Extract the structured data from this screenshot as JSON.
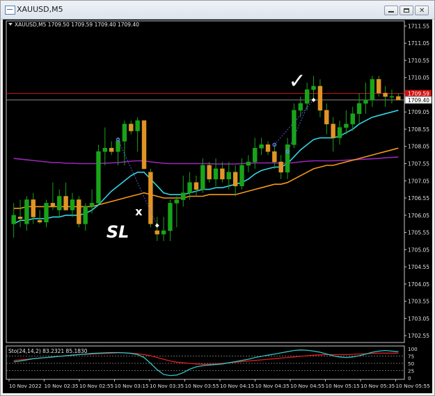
{
  "window": {
    "title": "XAUUSD,M5",
    "minimize_icon": "minimize-icon",
    "restore_icon": "restore-icon",
    "close_icon": "close-icon"
  },
  "chart": {
    "info_label": "XAUUSD,M5  1709.50 1709.59 1709.40 1709.40",
    "current_price_label": "1709.40",
    "red_line_label": "1709.59",
    "colors": {
      "background": "#000000",
      "bull_candle": "#19a319",
      "bear_candle": "#e19426",
      "ma_cyan": "#33d6e6",
      "ma_orange": "#f59a18",
      "ma_purple": "#9a28b8",
      "red_line": "#d01010"
    },
    "annotations": {
      "checkmark": "✓",
      "sl_text": "SL",
      "x_mark": "x"
    }
  },
  "stochastic": {
    "label": "Sto(24,14,2) 83.2321 85.1830",
    "levels": [
      "100",
      "75",
      "50",
      "25",
      "0"
    ]
  },
  "chart_data": {
    "type": "candlestick",
    "symbol": "XAUUSD",
    "timeframe": "M5",
    "y_ticks": [
      "1711.55",
      "1711.05",
      "1710.55",
      "1710.05",
      "1709.55",
      "1709.05",
      "1708.55",
      "1708.05",
      "1707.55",
      "1707.05",
      "1706.55",
      "1706.05",
      "1705.55",
      "1705.05",
      "1704.55",
      "1704.05",
      "1703.55",
      "1703.05",
      "1702.55"
    ],
    "x_ticks": [
      "10 Nov 2022",
      "10 Nov 02:35",
      "10 Nov 02:55",
      "10 Nov 03:15",
      "10 Nov 03:35",
      "10 Nov 03:55",
      "10 Nov 04:15",
      "10 Nov 04:35",
      "10 Nov 04:55",
      "10 Nov 05:15",
      "10 Nov 05:35",
      "10 Nov 05:55"
    ],
    "ylim": [
      1702.35,
      1711.7
    ],
    "candles": [
      {
        "o": 1705.8,
        "h": 1706.4,
        "l": 1705.4,
        "c": 1706.05
      },
      {
        "o": 1706.0,
        "h": 1706.5,
        "l": 1705.7,
        "c": 1705.95
      },
      {
        "o": 1705.8,
        "h": 1706.6,
        "l": 1705.6,
        "c": 1706.5
      },
      {
        "o": 1706.5,
        "h": 1706.7,
        "l": 1705.8,
        "c": 1706.0
      },
      {
        "o": 1705.9,
        "h": 1706.2,
        "l": 1705.8,
        "c": 1705.85
      },
      {
        "o": 1705.85,
        "h": 1706.5,
        "l": 1705.7,
        "c": 1706.4
      },
      {
        "o": 1706.4,
        "h": 1707.0,
        "l": 1706.2,
        "c": 1706.3
      },
      {
        "o": 1706.2,
        "h": 1706.8,
        "l": 1706.0,
        "c": 1706.6
      },
      {
        "o": 1706.6,
        "h": 1707.0,
        "l": 1706.2,
        "c": 1706.2
      },
      {
        "o": 1706.2,
        "h": 1706.7,
        "l": 1706.0,
        "c": 1706.5
      },
      {
        "o": 1706.5,
        "h": 1706.6,
        "l": 1705.7,
        "c": 1705.8
      },
      {
        "o": 1705.8,
        "h": 1706.4,
        "l": 1705.6,
        "c": 1706.3
      },
      {
        "o": 1706.3,
        "h": 1706.8,
        "l": 1706.1,
        "c": 1706.4
      },
      {
        "o": 1706.4,
        "h": 1708.1,
        "l": 1706.4,
        "c": 1707.9
      },
      {
        "o": 1707.9,
        "h": 1708.6,
        "l": 1707.5,
        "c": 1708.0
      },
      {
        "o": 1708.0,
        "h": 1708.2,
        "l": 1707.8,
        "c": 1707.9
      },
      {
        "o": 1707.9,
        "h": 1708.3,
        "l": 1707.5,
        "c": 1708.2
      },
      {
        "o": 1708.2,
        "h": 1708.8,
        "l": 1707.5,
        "c": 1708.7
      },
      {
        "o": 1708.7,
        "h": 1708.8,
        "l": 1708.4,
        "c": 1708.5
      },
      {
        "o": 1708.5,
        "h": 1708.9,
        "l": 1707.9,
        "c": 1708.8
      },
      {
        "o": 1708.8,
        "h": 1708.8,
        "l": 1707.4,
        "c": 1707.4
      },
      {
        "o": 1707.3,
        "h": 1707.4,
        "l": 1705.7,
        "c": 1705.8
      },
      {
        "o": 1705.6,
        "h": 1706.0,
        "l": 1705.3,
        "c": 1705.5
      },
      {
        "o": 1705.5,
        "h": 1706.0,
        "l": 1705.3,
        "c": 1705.6
      },
      {
        "o": 1705.6,
        "h": 1706.5,
        "l": 1705.3,
        "c": 1706.4
      },
      {
        "o": 1706.4,
        "h": 1706.6,
        "l": 1705.7,
        "c": 1706.5
      },
      {
        "o": 1706.5,
        "h": 1707.2,
        "l": 1706.3,
        "c": 1706.7
      },
      {
        "o": 1706.7,
        "h": 1707.3,
        "l": 1706.5,
        "c": 1707.0
      },
      {
        "o": 1707.0,
        "h": 1707.2,
        "l": 1706.6,
        "c": 1706.8
      },
      {
        "o": 1706.8,
        "h": 1707.7,
        "l": 1706.7,
        "c": 1707.5
      },
      {
        "o": 1707.5,
        "h": 1707.6,
        "l": 1707.0,
        "c": 1707.1
      },
      {
        "o": 1707.1,
        "h": 1707.7,
        "l": 1706.9,
        "c": 1707.4
      },
      {
        "o": 1707.4,
        "h": 1707.6,
        "l": 1707.0,
        "c": 1707.1
      },
      {
        "o": 1707.1,
        "h": 1707.6,
        "l": 1706.8,
        "c": 1707.3
      },
      {
        "o": 1707.3,
        "h": 1707.5,
        "l": 1706.6,
        "c": 1706.9
      },
      {
        "o": 1706.9,
        "h": 1707.7,
        "l": 1706.8,
        "c": 1707.5
      },
      {
        "o": 1707.5,
        "h": 1707.8,
        "l": 1707.3,
        "c": 1707.6
      },
      {
        "o": 1707.6,
        "h": 1708.3,
        "l": 1707.4,
        "c": 1708.0
      },
      {
        "o": 1708.0,
        "h": 1708.3,
        "l": 1707.8,
        "c": 1708.1
      },
      {
        "o": 1708.1,
        "h": 1708.2,
        "l": 1707.8,
        "c": 1707.9
      },
      {
        "o": 1707.9,
        "h": 1708.1,
        "l": 1707.4,
        "c": 1707.6
      },
      {
        "o": 1707.6,
        "h": 1707.8,
        "l": 1707.1,
        "c": 1707.3
      },
      {
        "o": 1707.3,
        "h": 1708.3,
        "l": 1707.1,
        "c": 1708.1
      },
      {
        "o": 1708.1,
        "h": 1709.3,
        "l": 1708.0,
        "c": 1709.1
      },
      {
        "o": 1709.1,
        "h": 1709.5,
        "l": 1708.9,
        "c": 1709.3
      },
      {
        "o": 1709.3,
        "h": 1709.9,
        "l": 1709.1,
        "c": 1709.7
      },
      {
        "o": 1709.7,
        "h": 1710.1,
        "l": 1709.4,
        "c": 1709.8
      },
      {
        "o": 1709.8,
        "h": 1710.0,
        "l": 1708.9,
        "c": 1709.1
      },
      {
        "o": 1709.1,
        "h": 1709.3,
        "l": 1708.4,
        "c": 1708.7
      },
      {
        "o": 1708.7,
        "h": 1708.9,
        "l": 1707.9,
        "c": 1708.3
      },
      {
        "o": 1708.3,
        "h": 1708.8,
        "l": 1708.1,
        "c": 1708.6
      },
      {
        "o": 1708.6,
        "h": 1709.1,
        "l": 1708.4,
        "c": 1708.7
      },
      {
        "o": 1708.7,
        "h": 1709.2,
        "l": 1708.5,
        "c": 1709.0
      },
      {
        "o": 1709.0,
        "h": 1709.6,
        "l": 1708.7,
        "c": 1709.3
      },
      {
        "o": 1709.3,
        "h": 1709.9,
        "l": 1709.0,
        "c": 1709.4
      },
      {
        "o": 1709.4,
        "h": 1710.1,
        "l": 1709.2,
        "c": 1710.0
      },
      {
        "o": 1710.0,
        "h": 1710.1,
        "l": 1709.5,
        "c": 1709.6
      },
      {
        "o": 1709.6,
        "h": 1709.8,
        "l": 1709.2,
        "c": 1709.5
      },
      {
        "o": 1709.5,
        "h": 1709.7,
        "l": 1709.3,
        "c": 1709.5
      },
      {
        "o": 1709.5,
        "h": 1709.6,
        "l": 1709.4,
        "c": 1709.4
      }
    ],
    "ma_cyan": [
      1705.8,
      1705.9,
      1705.9,
      1705.95,
      1705.95,
      1705.95,
      1706.0,
      1706.0,
      1706.05,
      1706.05,
      1706.05,
      1706.1,
      1706.2,
      1706.35,
      1706.55,
      1706.75,
      1706.9,
      1707.05,
      1707.2,
      1707.3,
      1707.3,
      1707.1,
      1706.9,
      1706.7,
      1706.65,
      1706.65,
      1706.65,
      1706.7,
      1706.75,
      1706.8,
      1706.8,
      1706.85,
      1706.85,
      1706.9,
      1706.95,
      1707.0,
      1707.1,
      1707.25,
      1707.35,
      1707.4,
      1707.45,
      1707.45,
      1707.55,
      1707.75,
      1707.95,
      1708.1,
      1708.25,
      1708.3,
      1708.3,
      1708.3,
      1708.35,
      1708.45,
      1708.55,
      1708.7,
      1708.8,
      1708.9,
      1708.95,
      1709.0,
      1709.05,
      1709.1
    ],
    "ma_orange": [
      1706.25,
      1706.25,
      1706.3,
      1706.3,
      1706.3,
      1706.3,
      1706.3,
      1706.3,
      1706.3,
      1706.3,
      1706.3,
      1706.3,
      1706.3,
      1706.35,
      1706.4,
      1706.45,
      1706.5,
      1706.55,
      1706.6,
      1706.65,
      1706.7,
      1706.65,
      1706.6,
      1706.55,
      1706.55,
      1706.55,
      1706.55,
      1706.6,
      1706.6,
      1706.6,
      1706.65,
      1706.65,
      1706.65,
      1706.65,
      1706.65,
      1706.7,
      1706.75,
      1706.8,
      1706.85,
      1706.9,
      1706.95,
      1706.95,
      1707.0,
      1707.1,
      1707.2,
      1707.3,
      1707.4,
      1707.45,
      1707.5,
      1707.5,
      1707.55,
      1707.6,
      1707.65,
      1707.7,
      1707.75,
      1707.8,
      1707.85,
      1707.9,
      1707.95,
      1708.0
    ],
    "ma_purple": [
      1707.7,
      1707.68,
      1707.66,
      1707.64,
      1707.62,
      1707.6,
      1707.58,
      1707.58,
      1707.56,
      1707.56,
      1707.55,
      1707.55,
      1707.55,
      1707.55,
      1707.56,
      1707.57,
      1707.58,
      1707.6,
      1707.62,
      1707.63,
      1707.63,
      1707.6,
      1707.58,
      1707.56,
      1707.55,
      1707.55,
      1707.55,
      1707.55,
      1707.55,
      1707.55,
      1707.55,
      1707.54,
      1707.54,
      1707.54,
      1707.54,
      1707.55,
      1707.56,
      1707.57,
      1707.57,
      1707.57,
      1707.57,
      1707.56,
      1707.56,
      1707.58,
      1707.6,
      1707.62,
      1707.63,
      1707.63,
      1707.63,
      1707.63,
      1707.64,
      1707.65,
      1707.66,
      1707.67,
      1707.68,
      1707.69,
      1707.7,
      1707.72,
      1707.73,
      1707.74
    ],
    "sto_main": [
      55,
      58,
      62,
      66,
      68,
      70,
      72,
      74,
      76,
      78,
      80,
      82,
      84,
      85,
      86,
      87,
      87,
      86,
      84,
      80,
      70,
      50,
      28,
      12,
      8,
      10,
      18,
      30,
      38,
      42,
      44,
      46,
      48,
      52,
      56,
      60,
      64,
      70,
      74,
      78,
      82,
      86,
      90,
      94,
      96,
      95,
      92,
      88,
      82,
      76,
      72,
      70,
      72,
      76,
      82,
      88,
      92,
      94,
      92,
      90
    ],
    "sto_signal": [
      60,
      62,
      64,
      66,
      68,
      70,
      72,
      74,
      76,
      78,
      80,
      81,
      82,
      83,
      84,
      85,
      86,
      86,
      85,
      83,
      80,
      76,
      70,
      64,
      58,
      54,
      52,
      50,
      48,
      47,
      47,
      48,
      50,
      52,
      54,
      56,
      58,
      60,
      62,
      64,
      66,
      68,
      70,
      72,
      74,
      76,
      78,
      79,
      80,
      80,
      80,
      80,
      81,
      82,
      83,
      84,
      85,
      85,
      85,
      85
    ]
  }
}
